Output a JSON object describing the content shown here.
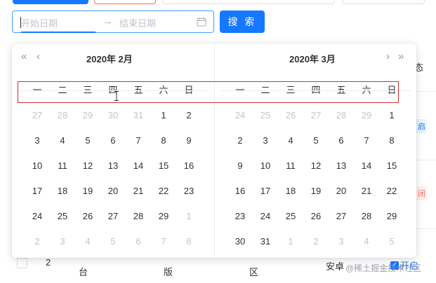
{
  "range_picker": {
    "start_placeholder": "开始日期",
    "separator": "→",
    "end_placeholder": "结束日期"
  },
  "search_button": "搜 索",
  "table": {
    "header_partial": "态",
    "tag1_partial": "启",
    "tag2_partial": "闭",
    "bottom_row": {
      "index": "2",
      "col1": "台",
      "col2": "版",
      "col3": "区",
      "col4": "安卓",
      "switch_text": "开启"
    }
  },
  "watermark": "@稀土掘金技术社区",
  "calendar": {
    "nav": {
      "prev_year": "«",
      "prev_month": "‹",
      "next_month": "›",
      "next_year": "»"
    },
    "weekdays": [
      "一",
      "二",
      "三",
      "四",
      "五",
      "六",
      "日"
    ],
    "left": {
      "title": "2020年  2月",
      "days": [
        [
          "27",
          "28",
          "29",
          "30",
          "31",
          "1",
          "2"
        ],
        [
          "3",
          "4",
          "5",
          "6",
          "7",
          "8",
          "9"
        ],
        [
          "10",
          "11",
          "12",
          "13",
          "14",
          "15",
          "16"
        ],
        [
          "17",
          "18",
          "19",
          "20",
          "21",
          "22",
          "23"
        ],
        [
          "24",
          "25",
          "26",
          "27",
          "28",
          "29",
          "1"
        ],
        [
          "2",
          "3",
          "4",
          "5",
          "6",
          "7",
          "8"
        ]
      ],
      "off": [
        [
          true,
          true,
          true,
          true,
          true,
          false,
          false
        ],
        [
          false,
          false,
          false,
          false,
          false,
          false,
          false
        ],
        [
          false,
          false,
          false,
          false,
          false,
          false,
          false
        ],
        [
          false,
          false,
          false,
          false,
          false,
          false,
          false
        ],
        [
          false,
          false,
          false,
          false,
          false,
          false,
          true
        ],
        [
          true,
          true,
          true,
          true,
          true,
          true,
          true
        ]
      ]
    },
    "right": {
      "title": "2020年  3月",
      "days": [
        [
          "24",
          "25",
          "26",
          "27",
          "28",
          "29",
          "1"
        ],
        [
          "2",
          "3",
          "4",
          "5",
          "6",
          "7",
          "8"
        ],
        [
          "9",
          "10",
          "11",
          "12",
          "13",
          "14",
          "15"
        ],
        [
          "16",
          "17",
          "18",
          "19",
          "20",
          "21",
          "22"
        ],
        [
          "23",
          "24",
          "25",
          "26",
          "27",
          "28",
          "29"
        ],
        [
          "30",
          "31",
          "1",
          "2",
          "3",
          "4",
          "5"
        ]
      ],
      "off": [
        [
          true,
          true,
          true,
          true,
          true,
          true,
          false
        ],
        [
          false,
          false,
          false,
          false,
          false,
          false,
          false
        ],
        [
          false,
          false,
          false,
          false,
          false,
          false,
          false
        ],
        [
          false,
          false,
          false,
          false,
          false,
          false,
          false
        ],
        [
          false,
          false,
          false,
          false,
          false,
          false,
          false
        ],
        [
          false,
          false,
          true,
          true,
          true,
          true,
          true
        ]
      ]
    }
  },
  "colors": {
    "primary": "#1677ff",
    "highlight_box": "#d03030"
  }
}
